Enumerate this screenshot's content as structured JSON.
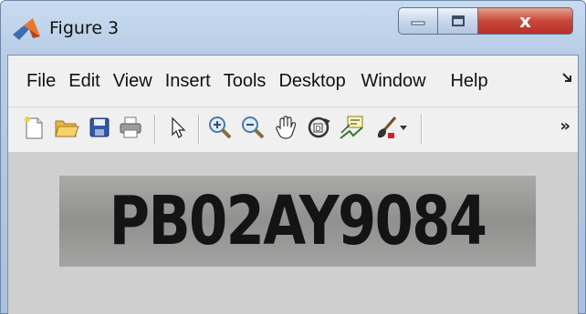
{
  "window": {
    "title": "Figure 3",
    "controls": {
      "minimize": "minimize-icon",
      "maximize": "maximize-icon",
      "close": "x"
    }
  },
  "menubar": {
    "items": [
      "File",
      "Edit",
      "View",
      "Insert",
      "Tools",
      "Desktop",
      "Window",
      "Help"
    ],
    "overflow_icon": "chevron-more-icon"
  },
  "toolbar": {
    "tools": [
      "new-figure-icon",
      "open-file-icon",
      "save-icon",
      "print-icon",
      "edit-plot-arrow-icon",
      "zoom-in-icon",
      "zoom-out-icon",
      "pan-hand-icon",
      "rotate-3d-icon",
      "data-cursor-icon",
      "brush-icon",
      "brush-dropdown-icon"
    ],
    "overflow_label": "»"
  },
  "figure": {
    "plate_text": "PB02AY9084",
    "background_color": "#cfcfcf",
    "plate_color": "#9b9c9a",
    "text_color": "#141414"
  }
}
